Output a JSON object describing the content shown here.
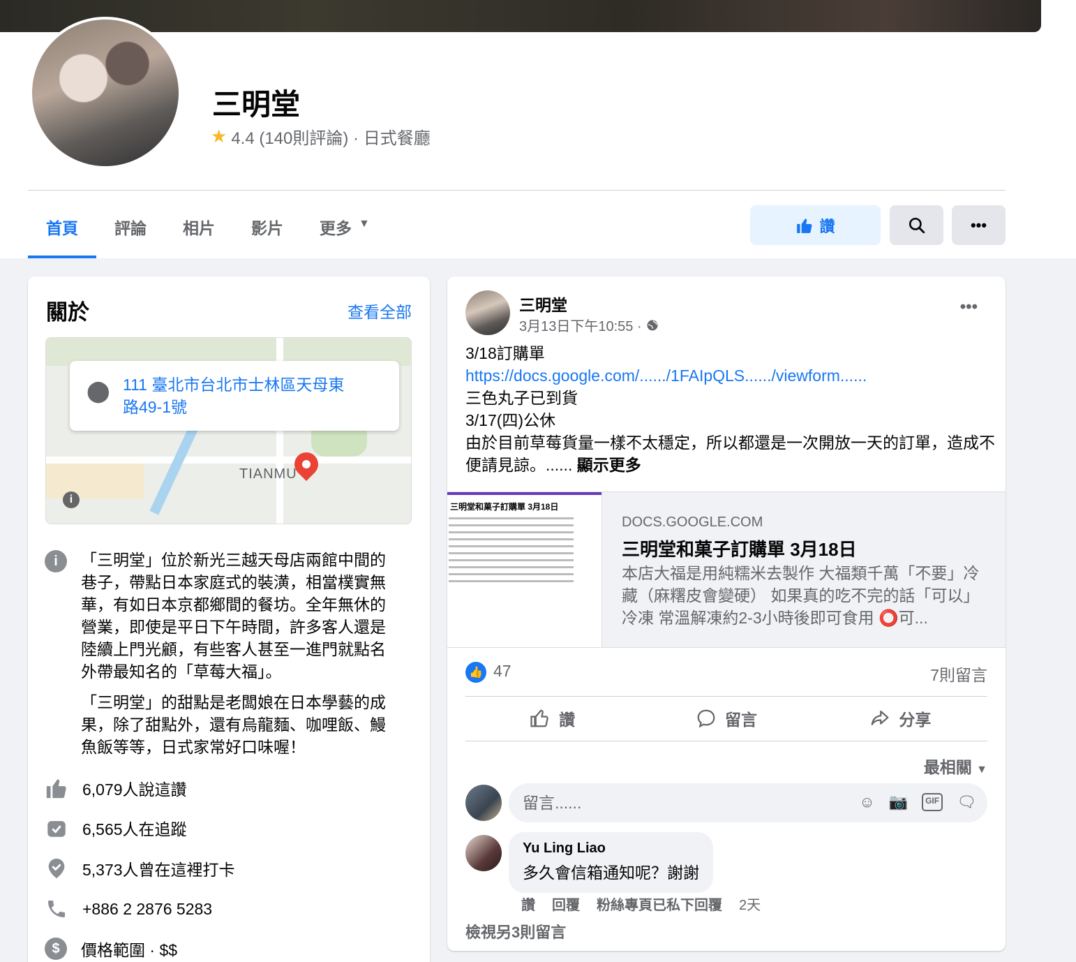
{
  "page": {
    "name": "三明堂",
    "rating": "4.4 (140則評論) · 日式餐廳"
  },
  "tabs": [
    {
      "label": "首頁"
    },
    {
      "label": "評論"
    },
    {
      "label": "相片"
    },
    {
      "label": "影片"
    },
    {
      "label": "更多"
    }
  ],
  "actions": {
    "like_label": "讚"
  },
  "about": {
    "title": "關於",
    "see_all": "查看全部",
    "address": "111 臺北市台北市士林區天母東路49-1號",
    "map_label": "TIANMU",
    "description": [
      "「三明堂」位於新光三越天母店兩館中間的巷子，帶點日本家庭式的裝潢，相當樸實無華，有如日本京都鄉間的餐坊。全年無休的營業，即使是平日下午時間，許多客人還是陸續上門光顧，有些客人甚至一進門就點名外帶最知名的「草莓大福」。",
      "「三明堂」的甜點是老闆娘在日本學藝的成果，除了甜點外，還有烏龍麵、咖哩飯、鰻魚飯等等，日式家常好口味喔！"
    ],
    "likes": "6,079人說這讚",
    "followers": "6,565人在追蹤",
    "checkins": "5,373人曾在這裡打卡",
    "phone": "+886 2 2876 5283",
    "price": "價格範圍 · $$"
  },
  "post": {
    "author": "三明堂",
    "time": "3月13日下午10:55 ·",
    "lines": [
      "3/18訂購單",
      "https://docs.google.com/....../1FAIpQLS....../viewform......",
      "三色丸子已到貨",
      "3/17(四)公休",
      "由於目前草莓貨量一樣不太穩定，所以都還是一次開放一天的訂單，造成不便請見諒。......"
    ],
    "see_more": "顯示更多",
    "link": {
      "thumb_title": "三明堂和菓子訂購單 3月18日",
      "domain": "DOCS.GOOGLE.COM",
      "title": "三明堂和菓子訂購單 3月18日",
      "description": "本店大福是用純糯米去製作 大福類千萬「不要」冷藏（麻糬皮會變硬） 如果真的吃不完的話「可以」冷凍 常溫解凍約2-3小時後即可食用 ⭕可..."
    },
    "reactions_count": "47",
    "comments_count": "7則留言",
    "action_like": "讚",
    "action_comment": "留言",
    "action_share": "分享",
    "sort_label": "最相關",
    "comment_placeholder": "留言......",
    "comment": {
      "author": "Yu Ling Liao",
      "text": "多久會信箱通知呢？謝謝",
      "like": "讚",
      "reply": "回覆",
      "page_replied": "粉絲專頁已私下回覆",
      "age": "2天"
    },
    "more_comments": "檢視另3則留言"
  }
}
